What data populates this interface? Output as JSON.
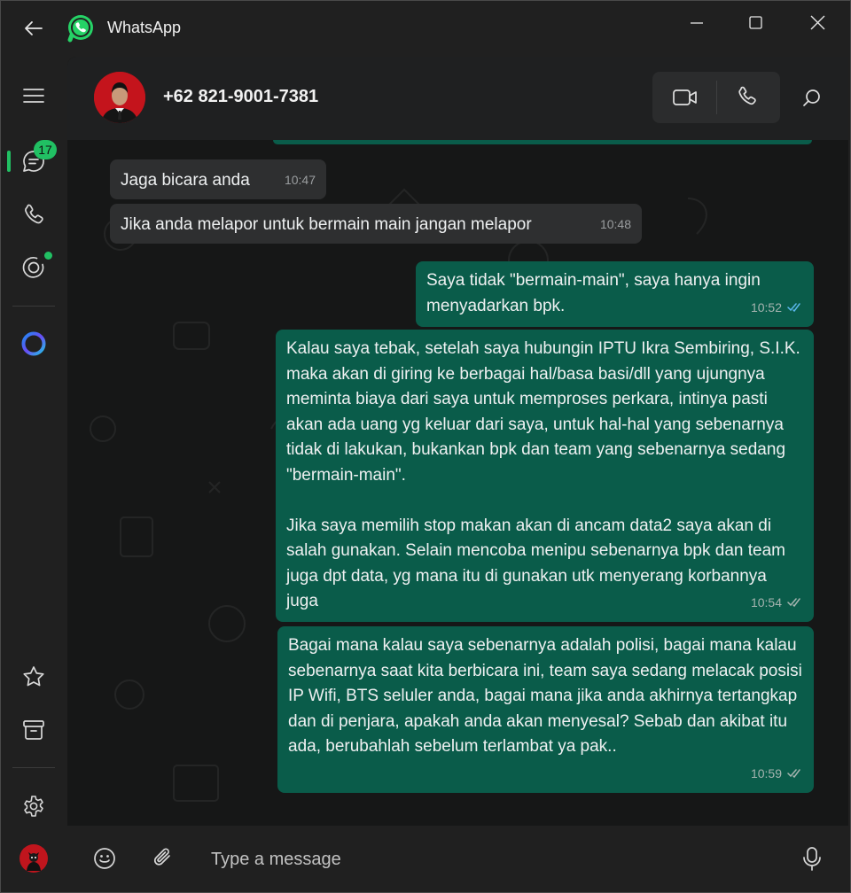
{
  "app": {
    "title": "WhatsApp"
  },
  "colors": {
    "accent": "#21c063",
    "outgoing_bubble": "#0a5c4a",
    "incoming_bubble": "#2e2f30",
    "read_ticks": "#5ab7ec"
  },
  "sidebar": {
    "items": [
      {
        "name": "menu",
        "icon": "hamburger-menu-icon"
      },
      {
        "name": "chats",
        "icon": "chat-icon",
        "badge": "17"
      },
      {
        "name": "calls",
        "icon": "phone-icon"
      },
      {
        "name": "status",
        "icon": "status-ring-icon"
      },
      {
        "name": "meta-ai",
        "icon": "meta-ai-ring-icon"
      },
      {
        "name": "starred",
        "icon": "star-icon"
      },
      {
        "name": "archived",
        "icon": "archive-icon"
      },
      {
        "name": "settings",
        "icon": "gear-icon"
      },
      {
        "name": "profile",
        "icon": "profile-avatar"
      }
    ]
  },
  "chat": {
    "contact": "+62 821-9001-7381",
    "actions": [
      "video-call-icon",
      "voice-call-icon",
      "search-icon"
    ],
    "messages": [
      {
        "dir": "in",
        "text": "Jaga bicara anda",
        "time": "10:47"
      },
      {
        "dir": "in",
        "text": "Jika anda melapor untuk bermain main jangan melapor",
        "time": "10:48"
      },
      {
        "dir": "out",
        "text": "Saya tidak \"bermain-main\", saya hanya ingin menyadarkan bpk.",
        "time": "10:52",
        "status": "read"
      },
      {
        "dir": "out",
        "text": "Kalau saya tebak, setelah saya hubungin IPTU Ikra Sembiring, S.I.K. maka akan di giring ke berbagai hal/basa basi/dll yang ujungnya meminta biaya dari saya untuk memproses perkara, intinya pasti akan ada uang yg keluar dari saya, untuk hal-hal yang sebenarnya tidak di lakukan, bukankan bpk dan team yang sebenarnya sedang \"bermain-main\".\n\nJika saya memilih stop makan akan di ancam data2 saya akan di salah gunakan. Selain mencoba menipu sebenarnya bpk dan team juga dpt data, yg mana itu di gunakan utk menyerang korbannya juga",
        "time": "10:54",
        "status": "delivered"
      },
      {
        "dir": "out",
        "text": "Bagai mana kalau saya sebenarnya adalah polisi, bagai mana kalau sebenarnya saat kita berbicara ini, team saya sedang melacak posisi IP Wifi, BTS seluler anda, bagai mana jika anda akhirnya tertangkap dan di penjara, apakah anda akan menyesal? Sebab dan akibat itu ada, berubahlah sebelum terlambat ya pak..",
        "time": "10:59",
        "status": "delivered"
      }
    ]
  },
  "composer": {
    "placeholder": "Type a message",
    "icons": [
      "emoji-icon",
      "attach-icon",
      "mic-icon"
    ]
  }
}
